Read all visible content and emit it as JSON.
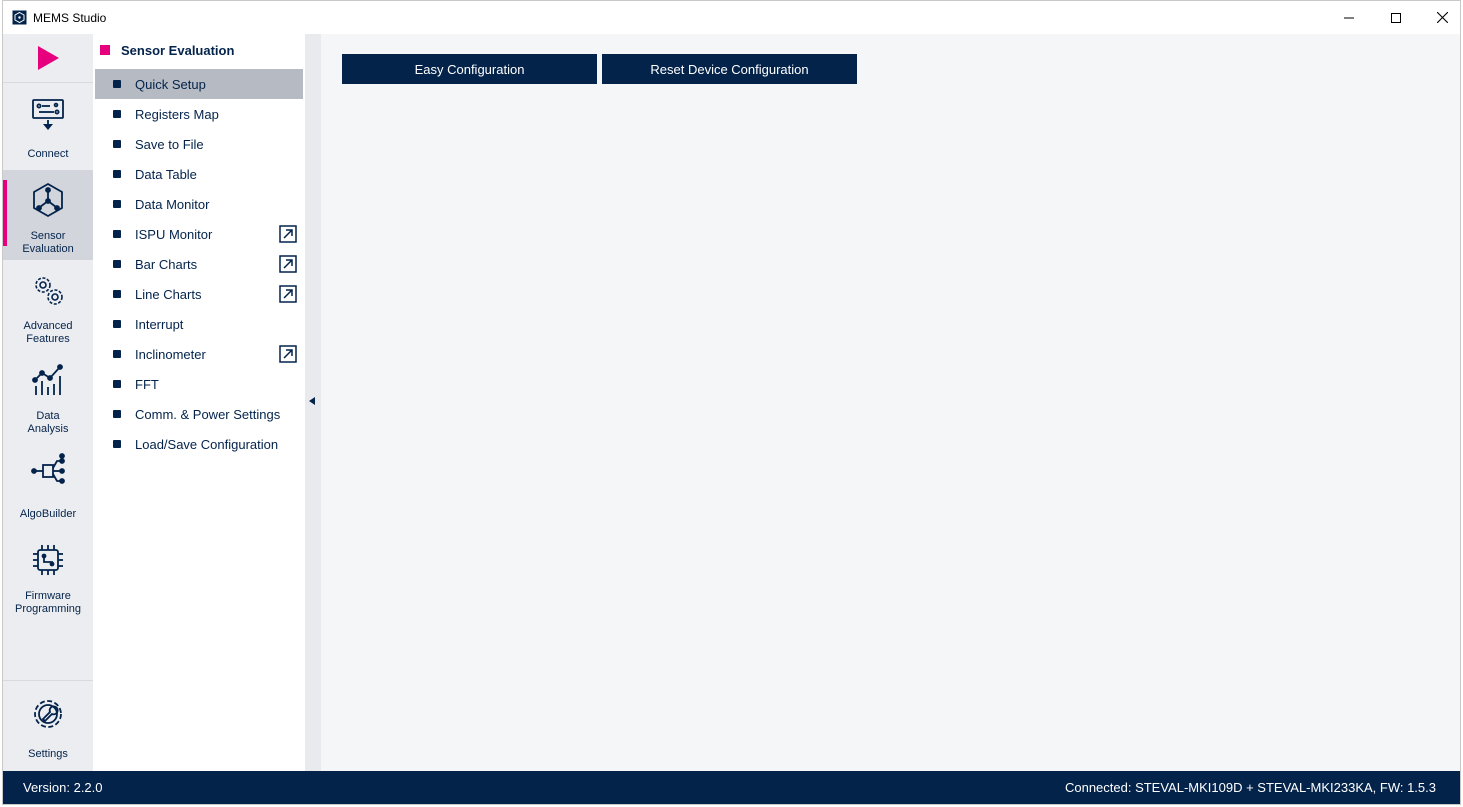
{
  "window": {
    "title": "MEMS Studio",
    "controls": {
      "minimize": "minimize-icon",
      "maximize": "maximize-icon",
      "close": "close-icon"
    }
  },
  "rail": {
    "play_icon": "play-icon",
    "items": [
      {
        "label": "Connect",
        "icon": "connect-board-icon",
        "active": false
      },
      {
        "label": "Sensor\nEvaluation",
        "icon": "sensor-cube-icon",
        "active": true
      },
      {
        "label": "Advanced\nFeatures",
        "icon": "gears-icon",
        "active": false
      },
      {
        "label": "Data\nAnalysis",
        "icon": "chart-analysis-icon",
        "active": false
      },
      {
        "label": "AlgoBuilder",
        "icon": "flow-graph-icon",
        "active": false
      },
      {
        "label": "Firmware\nProgramming",
        "icon": "chip-icon",
        "active": false
      }
    ],
    "settings": {
      "label": "Settings",
      "icon": "settings-gear-icon"
    }
  },
  "panel": {
    "title": "Sensor Evaluation",
    "items": [
      {
        "label": "Quick Setup",
        "selected": true,
        "popout": false
      },
      {
        "label": "Registers Map",
        "selected": false,
        "popout": false
      },
      {
        "label": "Save to File",
        "selected": false,
        "popout": false
      },
      {
        "label": "Data Table",
        "selected": false,
        "popout": false
      },
      {
        "label": "Data Monitor",
        "selected": false,
        "popout": false
      },
      {
        "label": "ISPU Monitor",
        "selected": false,
        "popout": true
      },
      {
        "label": "Bar Charts",
        "selected": false,
        "popout": true
      },
      {
        "label": "Line Charts",
        "selected": false,
        "popout": true
      },
      {
        "label": "Interrupt",
        "selected": false,
        "popout": false
      },
      {
        "label": "Inclinometer",
        "selected": false,
        "popout": true
      },
      {
        "label": "FFT",
        "selected": false,
        "popout": false
      },
      {
        "label": "Comm. & Power Settings",
        "selected": false,
        "popout": false
      },
      {
        "label": "Load/Save Configuration",
        "selected": false,
        "popout": false
      }
    ]
  },
  "main": {
    "buttons": {
      "easy": "Easy Configuration",
      "reset": "Reset Device Configuration"
    }
  },
  "status": {
    "version": "Version: 2.2.0",
    "connection": "Connected:  STEVAL-MKI109D + STEVAL-MKI233KA, FW: 1.5.3"
  },
  "colors": {
    "brand_navy": "#03234b",
    "accent_magenta": "#e6007e",
    "selected_bg": "#b6bac2"
  }
}
